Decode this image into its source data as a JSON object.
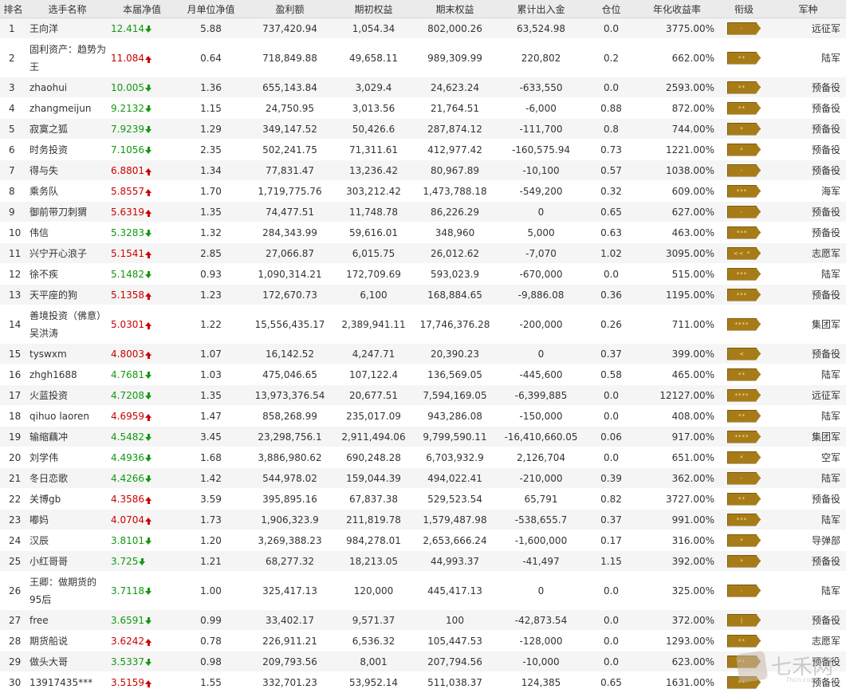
{
  "columns": [
    "排名",
    "选手名称",
    "本届净值",
    "月单位净值",
    "盈利额",
    "期初权益",
    "期末权益",
    "累计出入金",
    "仓位",
    "年化收益率",
    "衔级",
    "军种"
  ],
  "rows": [
    {
      "rank": "1",
      "name": "王向洋",
      "nav": "12.414",
      "dir": "down",
      "month": "5.88",
      "profit": "737,420.94",
      "begin": "1,054.34",
      "end": "802,000.26",
      "flow": "63,524.98",
      "pos": "0.0",
      "annual": "3775.00%",
      "insignia": "-",
      "branch": "远征军"
    },
    {
      "rank": "2",
      "name": "固利资产：趋势为王",
      "nav": "11.084",
      "dir": "up",
      "month": "0.64",
      "profit": "718,849.88",
      "begin": "49,658.11",
      "end": "989,309.99",
      "flow": "220,802",
      "pos": "0.2",
      "annual": "662.00%",
      "insignia": "**",
      "branch": "陆军",
      "tall": true
    },
    {
      "rank": "3",
      "name": "zhaohui",
      "nav": "10.005",
      "dir": "down",
      "month": "1.36",
      "profit": "655,143.84",
      "begin": "3,029.4",
      "end": "24,623.24",
      "flow": "-633,550",
      "pos": "0.0",
      "annual": "2593.00%",
      "insignia": "**",
      "branch": "预备役"
    },
    {
      "rank": "4",
      "name": "zhangmeijun",
      "nav": "9.2132",
      "dir": "down",
      "month": "1.15",
      "profit": "24,750.95",
      "begin": "3,013.56",
      "end": "21,764.51",
      "flow": "-6,000",
      "pos": "0.88",
      "annual": "872.00%",
      "insignia": "**",
      "branch": "预备役"
    },
    {
      "rank": "5",
      "name": "寂寞之狐",
      "nav": "7.9239",
      "dir": "down",
      "month": "1.29",
      "profit": "349,147.52",
      "begin": "50,426.6",
      "end": "287,874.12",
      "flow": "-111,700",
      "pos": "0.8",
      "annual": "744.00%",
      "insignia": "*",
      "branch": "预备役"
    },
    {
      "rank": "6",
      "name": "时务投资",
      "nav": "7.1056",
      "dir": "down",
      "month": "2.35",
      "profit": "502,241.75",
      "begin": "71,311.61",
      "end": "412,977.42",
      "flow": "-160,575.94",
      "pos": "0.73",
      "annual": "1221.00%",
      "insignia": "*",
      "branch": "预备役"
    },
    {
      "rank": "7",
      "name": "得与失",
      "nav": "6.8801",
      "dir": "up",
      "month": "1.34",
      "profit": "77,831.47",
      "begin": "13,236.42",
      "end": "80,967.89",
      "flow": "-10,100",
      "pos": "0.57",
      "annual": "1038.00%",
      "insignia": "-",
      "branch": "预备役"
    },
    {
      "rank": "8",
      "name": "乘务队",
      "nav": "5.8557",
      "dir": "up",
      "month": "1.70",
      "profit": "1,719,775.76",
      "begin": "303,212.42",
      "end": "1,473,788.18",
      "flow": "-549,200",
      "pos": "0.32",
      "annual": "609.00%",
      "insignia": "***",
      "branch": "海军"
    },
    {
      "rank": "9",
      "name": "御前带刀刺猬",
      "nav": "5.6319",
      "dir": "up",
      "month": "1.35",
      "profit": "74,477.51",
      "begin": "11,748.78",
      "end": "86,226.29",
      "flow": "0",
      "pos": "0.65",
      "annual": "627.00%",
      "insignia": "-",
      "branch": "预备役"
    },
    {
      "rank": "10",
      "name": "伟信",
      "nav": "5.3283",
      "dir": "down",
      "month": "1.32",
      "profit": "284,343.99",
      "begin": "59,616.01",
      "end": "348,960",
      "flow": "5,000",
      "pos": "0.63",
      "annual": "463.00%",
      "insignia": "***",
      "branch": "预备役"
    },
    {
      "rank": "11",
      "name": "兴宁开心浪子",
      "nav": "5.1541",
      "dir": "up",
      "month": "2.85",
      "profit": "27,066.87",
      "begin": "6,015.75",
      "end": "26,012.62",
      "flow": "-7,070",
      "pos": "1.02",
      "annual": "3095.00%",
      "insignia": "<< *",
      "branch": "志愿军"
    },
    {
      "rank": "12",
      "name": "徐不疾",
      "nav": "5.1482",
      "dir": "down",
      "month": "0.93",
      "profit": "1,090,314.21",
      "begin": "172,709.69",
      "end": "593,023.9",
      "flow": "-670,000",
      "pos": "0.0",
      "annual": "515.00%",
      "insignia": "***",
      "branch": "陆军"
    },
    {
      "rank": "13",
      "name": "天平座的狗",
      "nav": "5.1358",
      "dir": "up",
      "month": "1.23",
      "profit": "172,670.73",
      "begin": "6,100",
      "end": "168,884.65",
      "flow": "-9,886.08",
      "pos": "0.36",
      "annual": "1195.00%",
      "insignia": "***",
      "branch": "预备役"
    },
    {
      "rank": "14",
      "name": "善境投资（佛意）吴洪涛",
      "nav": "5.0301",
      "dir": "up",
      "month": "1.22",
      "profit": "15,556,435.17",
      "begin": "2,389,941.11",
      "end": "17,746,376.28",
      "flow": "-200,000",
      "pos": "0.26",
      "annual": "711.00%",
      "insignia": "****",
      "branch": "集团军",
      "tall": true
    },
    {
      "rank": "15",
      "name": "tyswxm",
      "nav": "4.8003",
      "dir": "up",
      "month": "1.07",
      "profit": "16,142.52",
      "begin": "4,247.71",
      "end": "20,390.23",
      "flow": "0",
      "pos": "0.37",
      "annual": "399.00%",
      "insignia": "<",
      "branch": "预备役"
    },
    {
      "rank": "16",
      "name": "zhgh1688",
      "nav": "4.7681",
      "dir": "down",
      "month": "1.03",
      "profit": "475,046.65",
      "begin": "107,122.4",
      "end": "136,569.05",
      "flow": "-445,600",
      "pos": "0.58",
      "annual": "465.00%",
      "insignia": "**",
      "branch": "陆军"
    },
    {
      "rank": "17",
      "name": "火蓝投资",
      "nav": "4.7208",
      "dir": "down",
      "month": "1.35",
      "profit": "13,973,376.54",
      "begin": "20,677.51",
      "end": "7,594,169.05",
      "flow": "-6,399,885",
      "pos": "0.0",
      "annual": "12127.00%",
      "insignia": "****",
      "branch": "远征军"
    },
    {
      "rank": "18",
      "name": "qihuo laoren",
      "nav": "4.6959",
      "dir": "up",
      "month": "1.47",
      "profit": "858,268.99",
      "begin": "235,017.09",
      "end": "943,286.08",
      "flow": "-150,000",
      "pos": "0.0",
      "annual": "408.00%",
      "insignia": "**",
      "branch": "陆军"
    },
    {
      "rank": "19",
      "name": "输缩藕冲",
      "nav": "4.5482",
      "dir": "down",
      "month": "3.45",
      "profit": "23,298,756.1",
      "begin": "2,911,494.06",
      "end": "9,799,590.11",
      "flow": "-16,410,660.05",
      "pos": "0.06",
      "annual": "917.00%",
      "insignia": "****",
      "branch": "集团军"
    },
    {
      "rank": "20",
      "name": "刘学伟",
      "nav": "4.4936",
      "dir": "down",
      "month": "1.68",
      "profit": "3,886,980.62",
      "begin": "690,248.28",
      "end": "6,703,932.9",
      "flow": "2,126,704",
      "pos": "0.0",
      "annual": "651.00%",
      "insignia": "*",
      "branch": "空军"
    },
    {
      "rank": "21",
      "name": "冬日恋歌",
      "nav": "4.4266",
      "dir": "down",
      "month": "1.42",
      "profit": "544,978.02",
      "begin": "159,044.39",
      "end": "494,022.41",
      "flow": "-210,000",
      "pos": "0.39",
      "annual": "362.00%",
      "insignia": "-",
      "branch": "陆军"
    },
    {
      "rank": "22",
      "name": "关博gb",
      "nav": "4.3586",
      "dir": "up",
      "month": "3.59",
      "profit": "395,895.16",
      "begin": "67,837.38",
      "end": "529,523.54",
      "flow": "65,791",
      "pos": "0.82",
      "annual": "3727.00%",
      "insignia": "**",
      "branch": "预备役"
    },
    {
      "rank": "23",
      "name": "嘟妈",
      "nav": "4.0704",
      "dir": "up",
      "month": "1.73",
      "profit": "1,906,323.9",
      "begin": "211,819.78",
      "end": "1,579,487.98",
      "flow": "-538,655.7",
      "pos": "0.37",
      "annual": "991.00%",
      "insignia": "***",
      "branch": "陆军"
    },
    {
      "rank": "24",
      "name": "汉辰",
      "nav": "3.8101",
      "dir": "down",
      "month": "1.20",
      "profit": "3,269,388.23",
      "begin": "984,278.01",
      "end": "2,653,666.24",
      "flow": "-1,600,000",
      "pos": "0.17",
      "annual": "316.00%",
      "insignia": "*",
      "branch": "导弹部"
    },
    {
      "rank": "25",
      "name": "小红哥哥",
      "nav": "3.725",
      "dir": "down",
      "month": "1.21",
      "profit": "68,277.32",
      "begin": "18,213.05",
      "end": "44,993.37",
      "flow": "-41,497",
      "pos": "1.15",
      "annual": "392.00%",
      "insignia": "*",
      "branch": "预备役"
    },
    {
      "rank": "26",
      "name": "王卿：做期货的95后",
      "nav": "3.7118",
      "dir": "down",
      "month": "1.00",
      "profit": "325,417.13",
      "begin": "120,000",
      "end": "445,417.13",
      "flow": "0",
      "pos": "0.0",
      "annual": "325.00%",
      "insignia": "-",
      "branch": "陆军",
      "tall": true
    },
    {
      "rank": "27",
      "name": "free",
      "nav": "3.6591",
      "dir": "down",
      "month": "0.99",
      "profit": "33,402.17",
      "begin": "9,571.37",
      "end": "100",
      "flow": "-42,873.54",
      "pos": "0.0",
      "annual": "372.00%",
      "insignia": "|",
      "branch": "预备役"
    },
    {
      "rank": "28",
      "name": "期货船说",
      "nav": "3.6242",
      "dir": "up",
      "month": "0.78",
      "profit": "226,911.21",
      "begin": "6,536.32",
      "end": "105,447.53",
      "flow": "-128,000",
      "pos": "0.0",
      "annual": "1293.00%",
      "insignia": "**",
      "branch": "志愿军"
    },
    {
      "rank": "29",
      "name": "做头大哥",
      "nav": "3.5337",
      "dir": "down",
      "month": "0.98",
      "profit": "209,793.56",
      "begin": "8,001",
      "end": "207,794.56",
      "flow": "-10,000",
      "pos": "0.0",
      "annual": "623.00%",
      "insignia": "**",
      "branch": "预备役"
    },
    {
      "rank": "30",
      "name": "13917435***",
      "nav": "3.5159",
      "dir": "up",
      "month": "1.55",
      "profit": "332,701.23",
      "begin": "53,952.14",
      "end": "511,038.37",
      "flow": "124,385",
      "pos": "0.65",
      "annual": "1631.00%",
      "insignia": "**",
      "branch": "预备役"
    }
  ],
  "watermark": {
    "text": "七禾网",
    "url": "7hcn.com"
  },
  "colors": {
    "up": "#cc0000",
    "down": "#119911",
    "header_bg": "#ebebeb",
    "insignia": "#a77c18"
  }
}
